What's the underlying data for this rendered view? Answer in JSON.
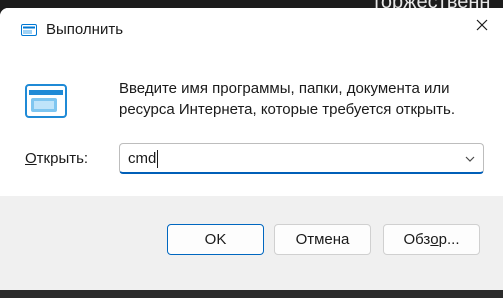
{
  "background": {
    "text": "торжественн"
  },
  "dialog": {
    "title": "Выполнить",
    "description": "Введите имя программы, папки, документа или ресурса Интернета, которые требуется открыть.",
    "open_label_prefix": "О",
    "open_label_rest": "ткрыть:",
    "input_value": "cmd",
    "buttons": {
      "ok": "OK",
      "cancel": "Отмена",
      "browse_prefix": "Обз",
      "browse_underlined": "о",
      "browse_rest": "р..."
    }
  },
  "colors": {
    "accent": "#005fb8",
    "dialog_bg": "#ffffff",
    "footer_bg": "#f0f0f0"
  },
  "icons": {
    "title": "run-icon",
    "main": "run-icon",
    "close": "close-icon",
    "dropdown": "chevron-down-icon"
  }
}
